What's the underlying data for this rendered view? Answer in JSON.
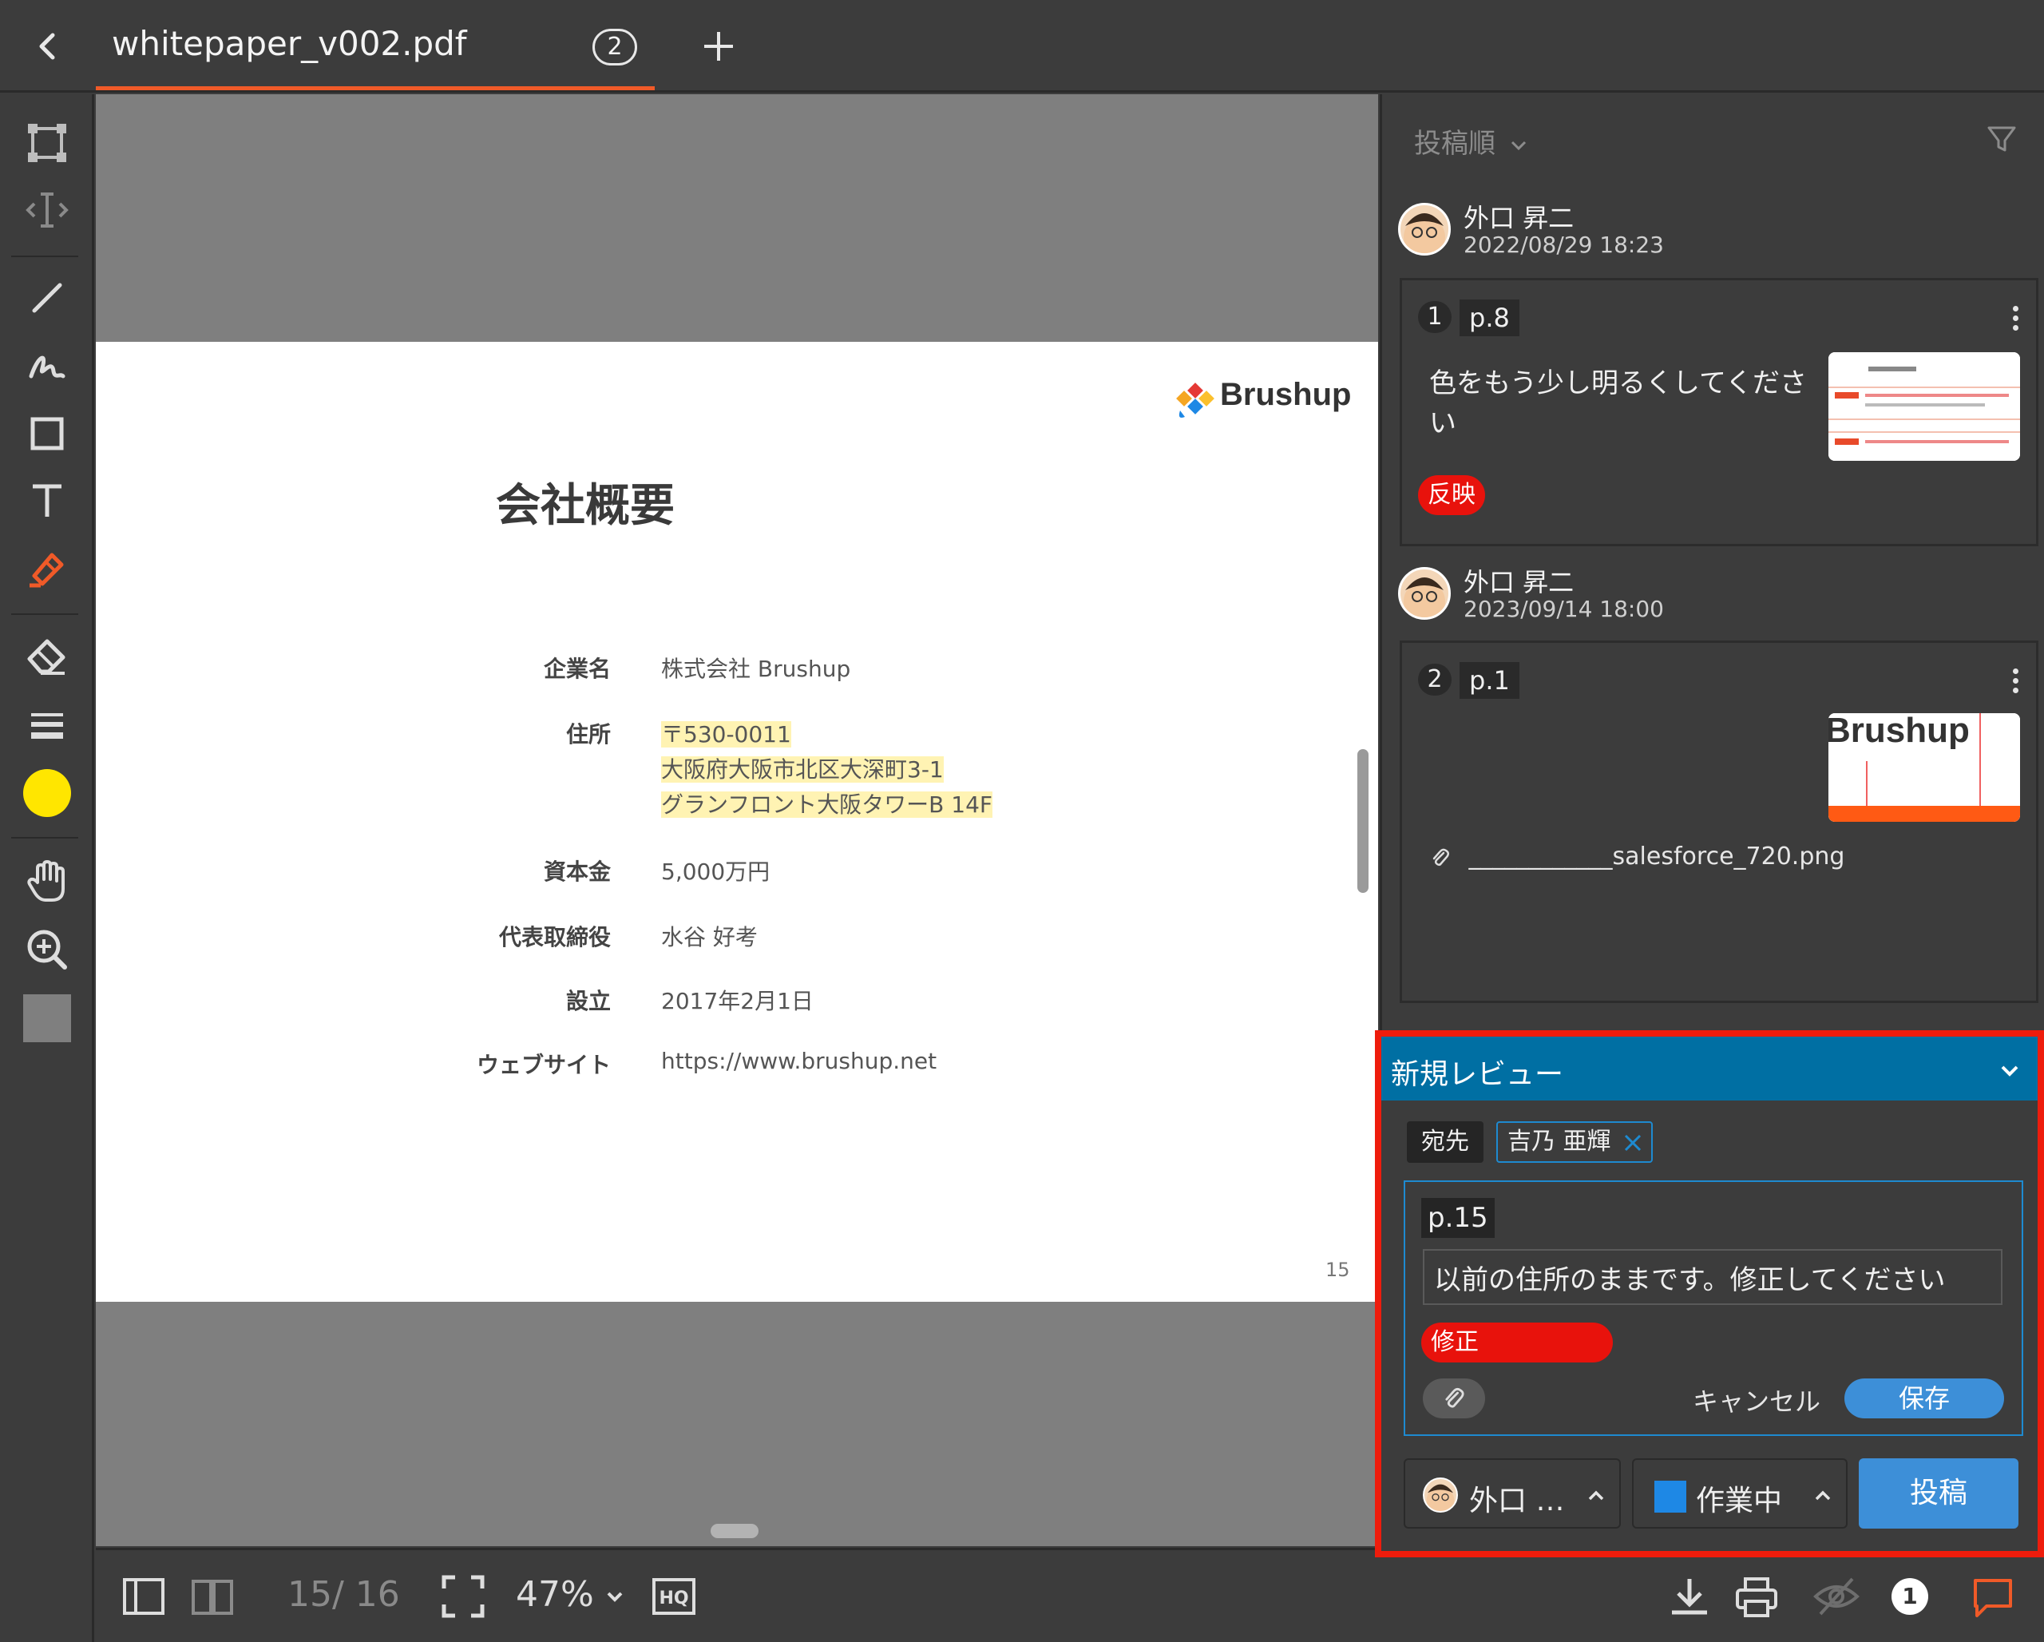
{
  "tab": {
    "title": "whitepaper_v002.pdf",
    "badge": "2"
  },
  "document": {
    "logo_text": "Brushup",
    "heading": "会社概要",
    "rows": [
      {
        "label": "企業名",
        "lines": [
          "株式会社 Brushup"
        ],
        "highlight": false
      },
      {
        "label": "住所",
        "lines": [
          "〒530-0011",
          "大阪府大阪市北区大深町3-1",
          "グランフロント大阪タワーB 14F"
        ],
        "highlight": true
      },
      {
        "label": "資本金",
        "lines": [
          "5,000万円"
        ],
        "highlight": false
      },
      {
        "label": "代表取締役",
        "lines": [
          "水谷 好考"
        ],
        "highlight": false
      },
      {
        "label": "設立",
        "lines": [
          "2017年2月1日"
        ],
        "highlight": false
      },
      {
        "label": "ウェブサイト",
        "lines": [
          "https://www.brushup.net"
        ],
        "highlight": false
      }
    ],
    "page_number": "15"
  },
  "bottom": {
    "page_counter": "15/ 16",
    "zoom": "47%",
    "hq_label": "HQ",
    "notification_count": "1"
  },
  "panel": {
    "sort_label": "投稿順",
    "comments": [
      {
        "author": "外口 昇二",
        "date": "2022/08/29 18:23",
        "number": "1",
        "page": "p.8",
        "text": "色をもう少し明るくしてください",
        "status": "反映",
        "attachment": ""
      },
      {
        "author": "外口 昇二",
        "date": "2023/09/14 18:00",
        "number": "2",
        "page": "p.1",
        "text": "",
        "status": "",
        "attachment": "____________salesforce_720.png",
        "thumb_text": "Brushup"
      }
    ]
  },
  "review": {
    "title": "新規レビュー",
    "to_label": "宛先",
    "recipient": "吉乃 亜輝",
    "page": "p.15",
    "input_value": "以前の住所のままです。修正してください",
    "status": "修正",
    "cancel": "キャンセル",
    "save": "保存",
    "author_short": "外口 …",
    "state": "作業中",
    "post": "投稿"
  },
  "colors": {
    "accent": "#f05a28",
    "review_header": "#006fa3",
    "highlight_border": "#ee1c0c",
    "primary_button": "#3d8fd8",
    "status_red": "#e8120c",
    "pen_color": "#ffe600"
  }
}
